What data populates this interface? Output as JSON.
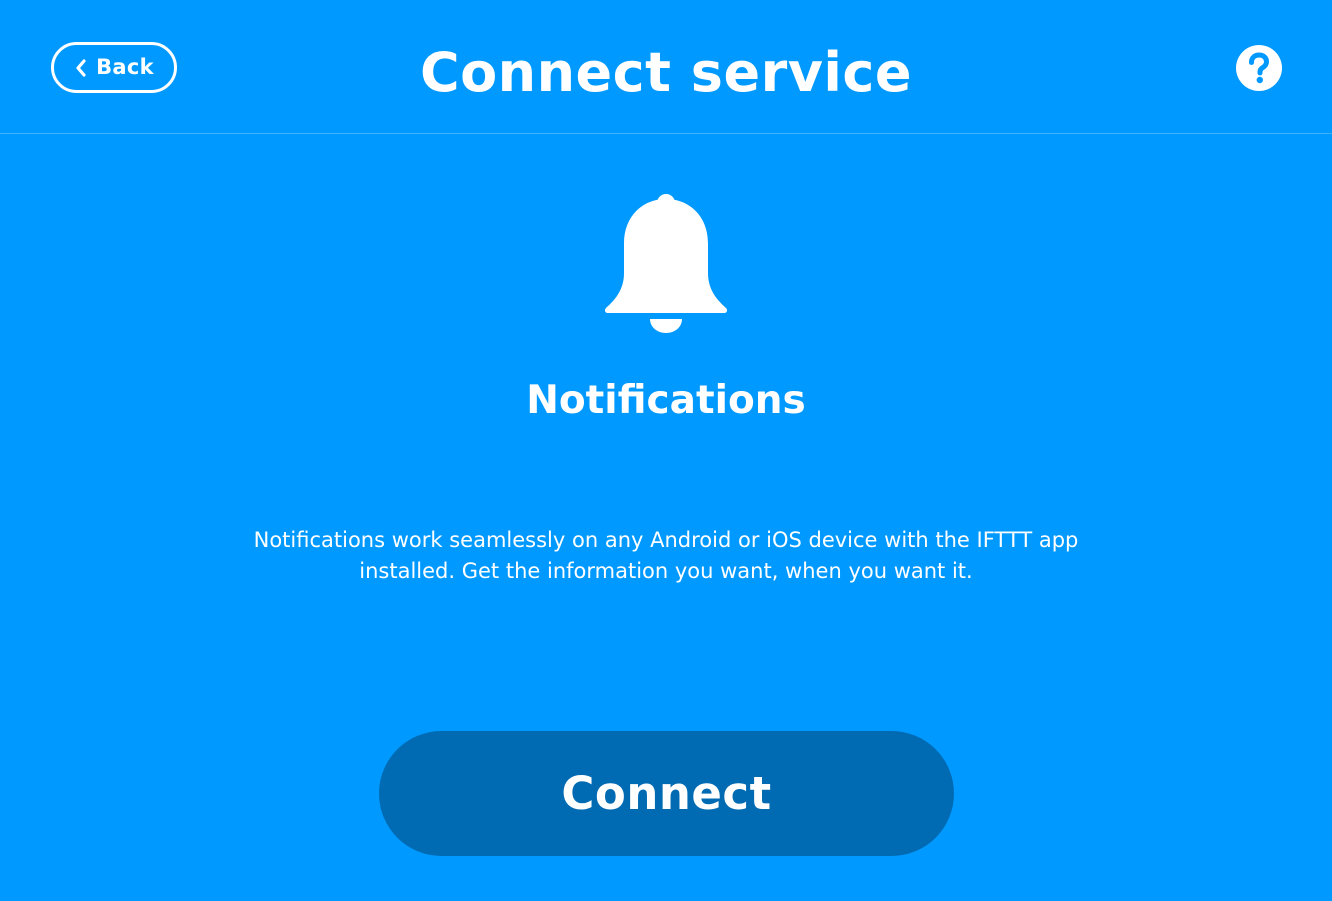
{
  "header": {
    "back_label": "Back",
    "title": "Connect service",
    "help_icon": "question-mark-icon"
  },
  "service": {
    "icon": "bell-icon",
    "name": "Notifications",
    "description": "Notifications work seamlessly on any Android or iOS device with the IFTTT app installed. Get the information you want, when you want it."
  },
  "actions": {
    "connect_label": "Connect"
  },
  "colors": {
    "background": "#0099ff",
    "connect_button": "#006bb3",
    "foreground": "#ffffff"
  }
}
